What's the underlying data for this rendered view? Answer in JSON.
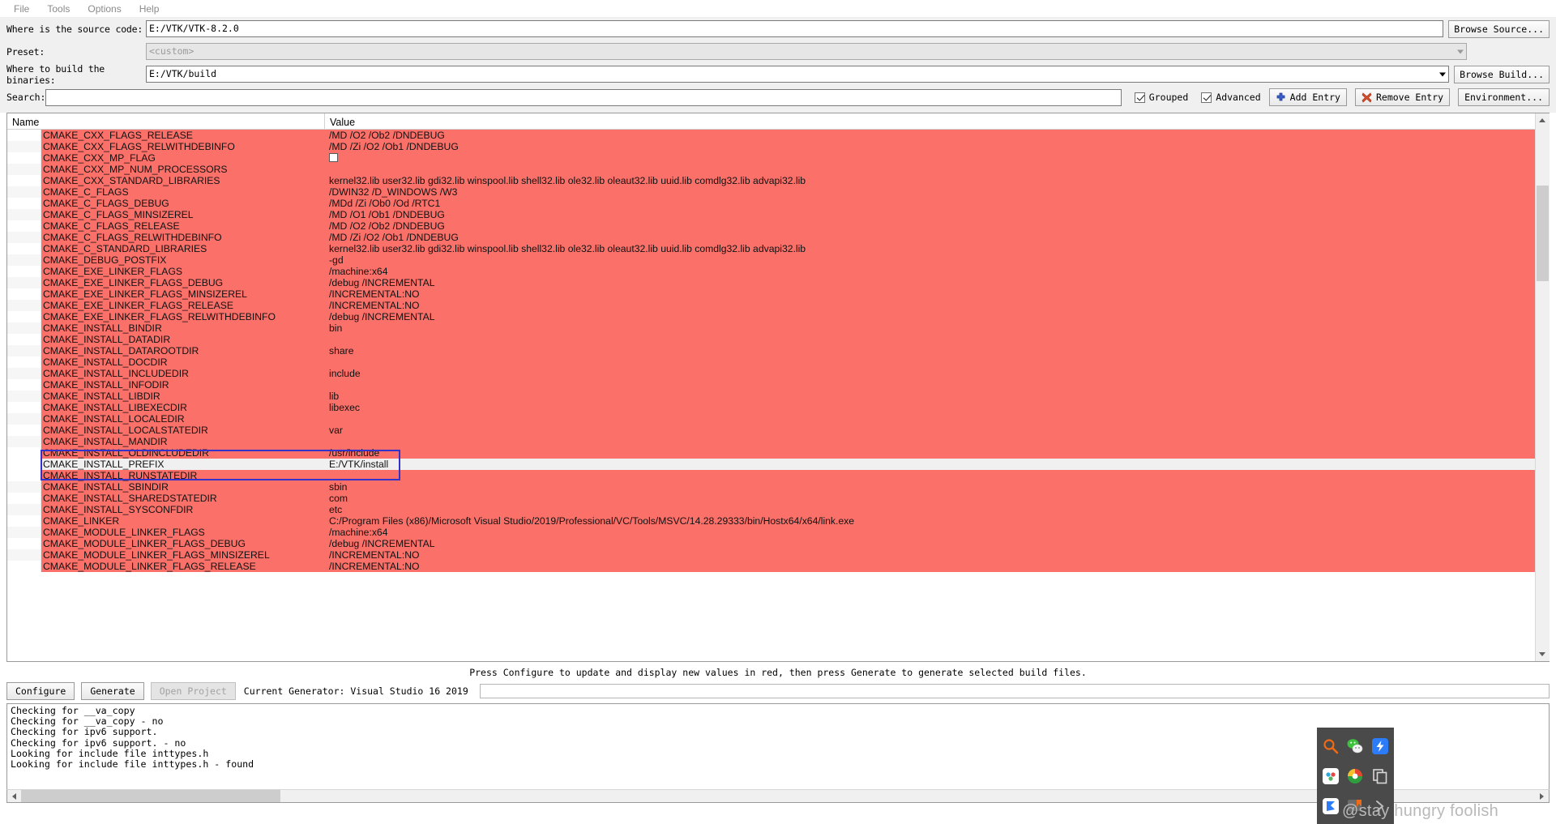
{
  "menu": {
    "items": [
      "File",
      "Tools",
      "Options",
      "Help"
    ]
  },
  "form": {
    "source_label": "Where is the source code:",
    "source_value": "E:/VTK/VTK-8.2.0",
    "browse_source_label": "Browse Source...",
    "preset_label": "Preset:",
    "preset_value": "<custom>",
    "build_label": "Where to build the binaries:",
    "build_value": "E:/VTK/build",
    "browse_build_label": "Browse Build..."
  },
  "search": {
    "label": "Search:",
    "value": "",
    "placeholder": "",
    "grouped_label": "Grouped",
    "grouped_checked": true,
    "advanced_label": "Advanced",
    "advanced_checked": true,
    "add_entry_label": "Add Entry",
    "remove_entry_label": "Remove Entry",
    "environment_label": "Environment..."
  },
  "table": {
    "headers": [
      "Name",
      "Value"
    ],
    "rows": [
      {
        "name": "CMAKE_CXX_FLAGS_RELEASE",
        "value": "/MD /O2 /Ob2 /DNDEBUG",
        "type": "text"
      },
      {
        "name": "CMAKE_CXX_FLAGS_RELWITHDEBINFO",
        "value": "/MD /Zi /O2 /Ob1 /DNDEBUG",
        "type": "text"
      },
      {
        "name": "CMAKE_CXX_MP_FLAG",
        "value": "",
        "type": "bool"
      },
      {
        "name": "CMAKE_CXX_MP_NUM_PROCESSORS",
        "value": "",
        "type": "text"
      },
      {
        "name": "CMAKE_CXX_STANDARD_LIBRARIES",
        "value": "kernel32.lib user32.lib gdi32.lib winspool.lib shell32.lib ole32.lib oleaut32.lib uuid.lib comdlg32.lib advapi32.lib",
        "type": "text"
      },
      {
        "name": "CMAKE_C_FLAGS",
        "value": "/DWIN32 /D_WINDOWS /W3",
        "type": "text"
      },
      {
        "name": "CMAKE_C_FLAGS_DEBUG",
        "value": "/MDd /Zi /Ob0 /Od /RTC1",
        "type": "text"
      },
      {
        "name": "CMAKE_C_FLAGS_MINSIZEREL",
        "value": "/MD /O1 /Ob1 /DNDEBUG",
        "type": "text"
      },
      {
        "name": "CMAKE_C_FLAGS_RELEASE",
        "value": "/MD /O2 /Ob2 /DNDEBUG",
        "type": "text"
      },
      {
        "name": "CMAKE_C_FLAGS_RELWITHDEBINFO",
        "value": "/MD /Zi /O2 /Ob1 /DNDEBUG",
        "type": "text"
      },
      {
        "name": "CMAKE_C_STANDARD_LIBRARIES",
        "value": "kernel32.lib user32.lib gdi32.lib winspool.lib shell32.lib ole32.lib oleaut32.lib uuid.lib comdlg32.lib advapi32.lib",
        "type": "text"
      },
      {
        "name": "CMAKE_DEBUG_POSTFIX",
        "value": "-gd",
        "type": "text"
      },
      {
        "name": "CMAKE_EXE_LINKER_FLAGS",
        "value": "/machine:x64",
        "type": "text"
      },
      {
        "name": "CMAKE_EXE_LINKER_FLAGS_DEBUG",
        "value": "/debug /INCREMENTAL",
        "type": "text"
      },
      {
        "name": "CMAKE_EXE_LINKER_FLAGS_MINSIZEREL",
        "value": "/INCREMENTAL:NO",
        "type": "text"
      },
      {
        "name": "CMAKE_EXE_LINKER_FLAGS_RELEASE",
        "value": "/INCREMENTAL:NO",
        "type": "text"
      },
      {
        "name": "CMAKE_EXE_LINKER_FLAGS_RELWITHDEBINFO",
        "value": "/debug /INCREMENTAL",
        "type": "text"
      },
      {
        "name": "CMAKE_INSTALL_BINDIR",
        "value": "bin",
        "type": "text"
      },
      {
        "name": "CMAKE_INSTALL_DATADIR",
        "value": "",
        "type": "text"
      },
      {
        "name": "CMAKE_INSTALL_DATAROOTDIR",
        "value": "share",
        "type": "text"
      },
      {
        "name": "CMAKE_INSTALL_DOCDIR",
        "value": "",
        "type": "text"
      },
      {
        "name": "CMAKE_INSTALL_INCLUDEDIR",
        "value": "include",
        "type": "text"
      },
      {
        "name": "CMAKE_INSTALL_INFODIR",
        "value": "",
        "type": "text"
      },
      {
        "name": "CMAKE_INSTALL_LIBDIR",
        "value": "lib",
        "type": "text"
      },
      {
        "name": "CMAKE_INSTALL_LIBEXECDIR",
        "value": "libexec",
        "type": "text"
      },
      {
        "name": "CMAKE_INSTALL_LOCALEDIR",
        "value": "",
        "type": "text"
      },
      {
        "name": "CMAKE_INSTALL_LOCALSTATEDIR",
        "value": "var",
        "type": "text"
      },
      {
        "name": "CMAKE_INSTALL_MANDIR",
        "value": "",
        "type": "text"
      },
      {
        "name": "CMAKE_INSTALL_OLDINCLUDEDIR",
        "value": "/usr/include",
        "type": "text"
      },
      {
        "name": "CMAKE_INSTALL_PREFIX",
        "value": "E:/VTK/install",
        "type": "text",
        "selected": true
      },
      {
        "name": "CMAKE_INSTALL_RUNSTATEDIR",
        "value": "",
        "type": "text"
      },
      {
        "name": "CMAKE_INSTALL_SBINDIR",
        "value": "sbin",
        "type": "text"
      },
      {
        "name": "CMAKE_INSTALL_SHAREDSTATEDIR",
        "value": "com",
        "type": "text"
      },
      {
        "name": "CMAKE_INSTALL_SYSCONFDIR",
        "value": "etc",
        "type": "text"
      },
      {
        "name": "CMAKE_LINKER",
        "value": "C:/Program Files (x86)/Microsoft Visual Studio/2019/Professional/VC/Tools/MSVC/14.28.29333/bin/Hostx64/x64/link.exe",
        "type": "text"
      },
      {
        "name": "CMAKE_MODULE_LINKER_FLAGS",
        "value": "/machine:x64",
        "type": "text"
      },
      {
        "name": "CMAKE_MODULE_LINKER_FLAGS_DEBUG",
        "value": "/debug /INCREMENTAL",
        "type": "text"
      },
      {
        "name": "CMAKE_MODULE_LINKER_FLAGS_MINSIZEREL",
        "value": "/INCREMENTAL:NO",
        "type": "text"
      },
      {
        "name": "CMAKE_MODULE_LINKER_FLAGS_RELEASE",
        "value": "/INCREMENTAL:NO",
        "type": "text"
      }
    ]
  },
  "status": {
    "message": "Press Configure to update and display new values in red, then press Generate to generate selected build files."
  },
  "actions": {
    "configure_label": "Configure",
    "generate_label": "Generate",
    "open_project_label": "Open Project",
    "open_project_disabled": true,
    "generator_label": "Current Generator: Visual Studio 16 2019"
  },
  "log": {
    "lines": [
      "Checking for __va_copy",
      "Checking for __va_copy - no",
      "Checking for ipv6 support.",
      "Checking for ipv6 support. - no",
      "Looking for include file inttypes.h",
      "Looking for include file inttypes.h - found"
    ]
  },
  "launcher": {
    "icons": [
      "magnifier-icon",
      "wechat-icon",
      "thunder-icon",
      "baidu-netdisk-icon",
      "idm-icon",
      "copy-icon",
      "flag-icon",
      "csdn-icon",
      "more-icon"
    ]
  },
  "watermark": {
    "text": "@stay hungry foolish"
  },
  "colors": {
    "row_modified": "#fb7069",
    "focus_rect": "#3333cc",
    "chrome": "#f0f0f0"
  }
}
